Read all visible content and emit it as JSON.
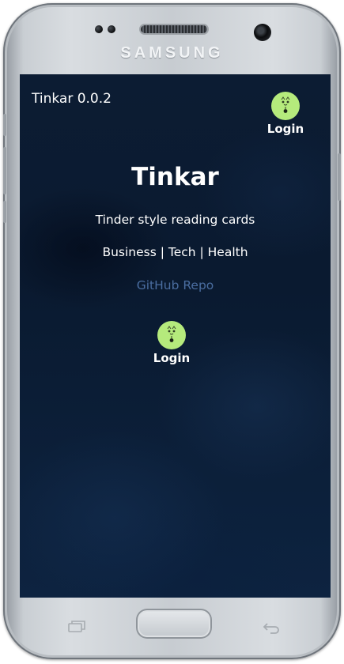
{
  "device": {
    "brand": "SAMSUNG"
  },
  "app": {
    "version_label": "Tinkar 0.0.2",
    "title": "Tinkar",
    "subtitle": "Tinder style reading cards",
    "categories": "Business | Tech | Health",
    "repo_link": "GitHub Repo"
  },
  "header_login": {
    "label": "Login",
    "icon": "avatar-icon"
  },
  "main_login": {
    "label": "Login",
    "icon": "avatar-icon"
  },
  "colors": {
    "background": "#0c1c33",
    "text": "#ffffff",
    "link": "#4a6da0",
    "avatar": "#b5ea7c"
  }
}
